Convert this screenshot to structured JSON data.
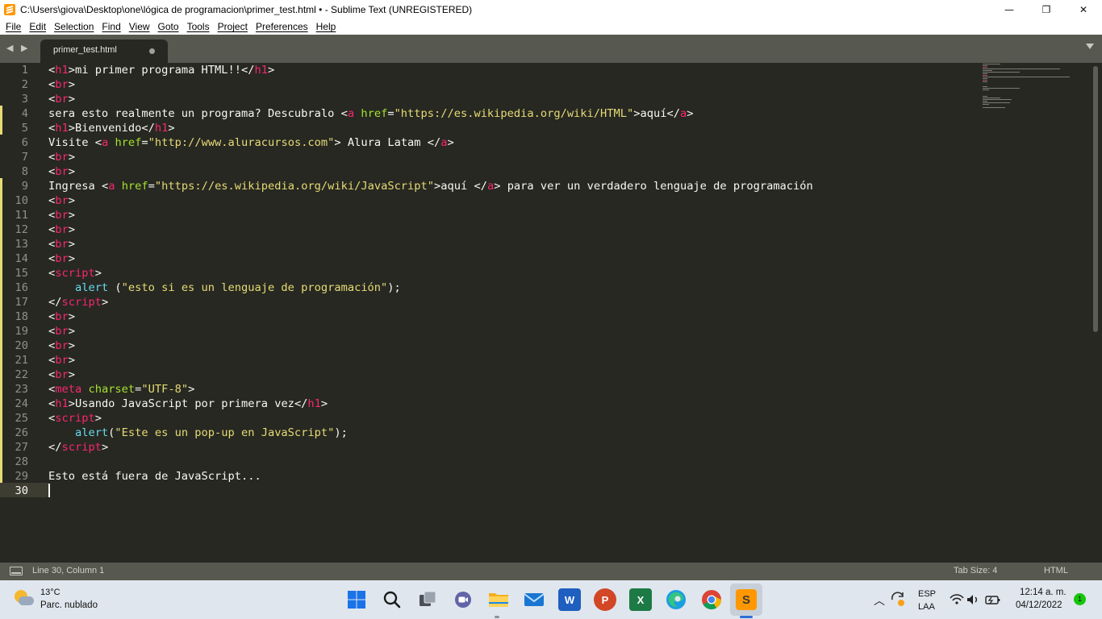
{
  "window": {
    "title": "C:\\Users\\giova\\Desktop\\one\\lógica de programacion\\primer_test.html • - Sublime Text (UNREGISTERED)",
    "minimize_glyph": "—",
    "maximize_glyph": "❐",
    "close_glyph": "✕"
  },
  "menu": [
    "File",
    "Edit",
    "Selection",
    "Find",
    "View",
    "Goto",
    "Tools",
    "Project",
    "Preferences",
    "Help"
  ],
  "tabs": {
    "nav_glyph": "◀ ▶",
    "active": {
      "label": "primer_test.html",
      "dirty": true
    }
  },
  "editor": {
    "lines": [
      {
        "n": "1"
      },
      {
        "n": "2"
      },
      {
        "n": "3"
      },
      {
        "n": "4"
      },
      {
        "n": "5"
      },
      {
        "n": "6"
      },
      {
        "n": "7"
      },
      {
        "n": "8"
      },
      {
        "n": "9"
      },
      {
        "n": "10"
      },
      {
        "n": "11"
      },
      {
        "n": "12"
      },
      {
        "n": "13"
      },
      {
        "n": "14"
      },
      {
        "n": "15"
      },
      {
        "n": "16"
      },
      {
        "n": "17"
      },
      {
        "n": "18"
      },
      {
        "n": "19"
      },
      {
        "n": "20"
      },
      {
        "n": "21"
      },
      {
        "n": "22"
      },
      {
        "n": "23"
      },
      {
        "n": "24"
      },
      {
        "n": "25"
      },
      {
        "n": "26"
      },
      {
        "n": "27"
      },
      {
        "n": "28"
      },
      {
        "n": "29"
      },
      {
        "n": "30"
      }
    ],
    "text": {
      "l1": "mi primer programa HTML!!",
      "l4a": "sera esto realmente un programa? Descubralo ",
      "l4url": "\"https://es.wikipedia.org/wiki/HTML\"",
      "l4b": "aquí",
      "l5": "Bienvenido",
      "l6a": "Visite ",
      "l6url": "\"http://www.aluracursos.com\"",
      "l6b": " Alura Latam ",
      "l9a": "Ingresa ",
      "l9url": "\"https://es.wikipedia.org/wiki/JavaScript\"",
      "l9b": "aquí ",
      "l9c": " para ver un verdadero lenguaje de programación",
      "l16fn": "alert",
      "l16str": "\"esto si es un lenguaje de programación\"",
      "l23str": "\"UTF-8\"",
      "l24": "Usando JavaScript por primera vez",
      "l26fn": "alert",
      "l26str": "\"Este es un pop-up en JavaScript\"",
      "l29": "Esto está fuera de JavaScript..."
    }
  },
  "status": {
    "position": "Line 30, Column 1",
    "tab_size": "Tab Size: 4",
    "syntax": "HTML"
  },
  "taskbar": {
    "weather_temp": "13°C",
    "weather_desc": "Parc. nublado",
    "lang_top": "ESP",
    "lang_bottom": "LAA",
    "time": "12:14 a. m.",
    "date": "04/12/2022",
    "notification_count": "1",
    "powerpoint_letter": "P",
    "word_letter": "W",
    "excel_letter": "X",
    "sublime_letter": "S"
  }
}
